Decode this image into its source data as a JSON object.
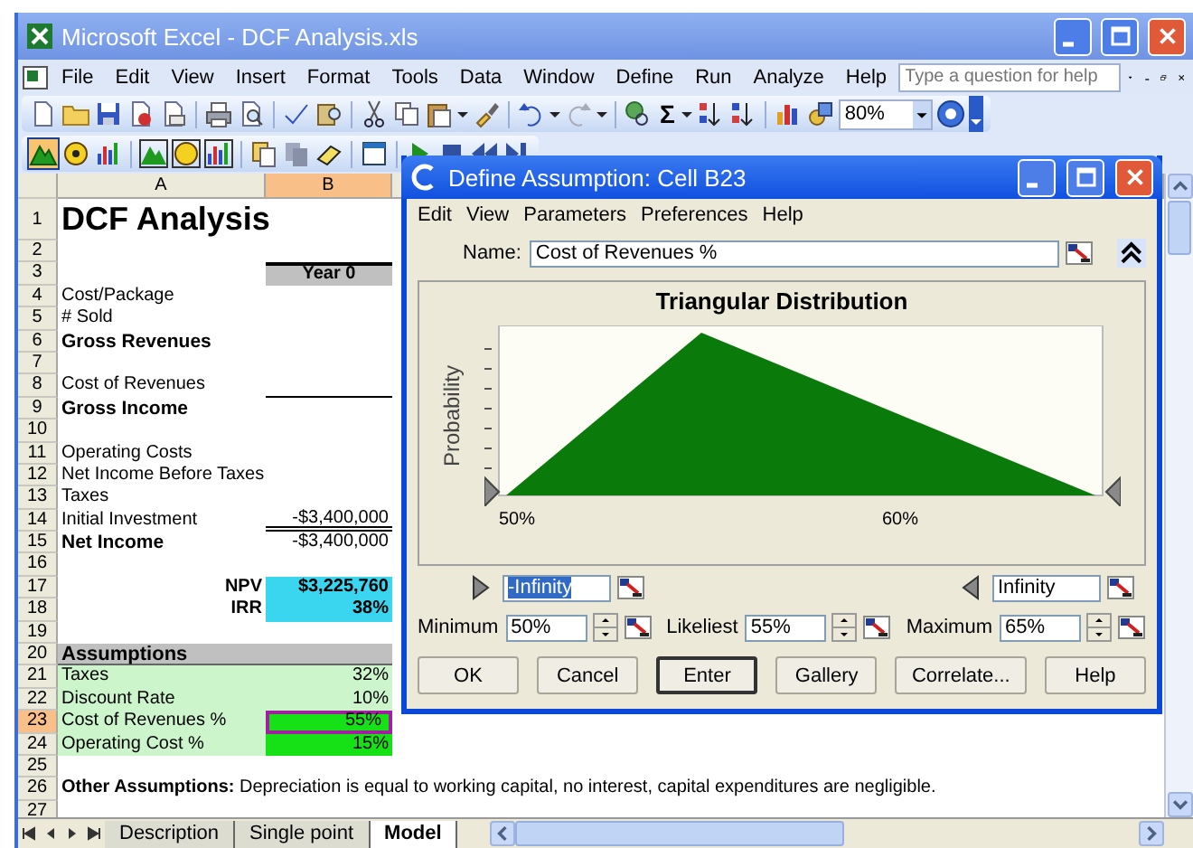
{
  "window": {
    "title": "Microsoft Excel - DCF Analysis.xls"
  },
  "menu": [
    "File",
    "Edit",
    "View",
    "Insert",
    "Format",
    "Tools",
    "Data",
    "Window",
    "Define",
    "Run",
    "Analyze",
    "Help"
  ],
  "help_search": {
    "placeholder": "Type a question for help"
  },
  "toolbar": {
    "autosum": "Σ",
    "zoom": "80%"
  },
  "crystal_toolbar": [
    {
      "selected": true
    },
    {
      "selected": false
    },
    {
      "selected": false
    },
    {
      "selected": false
    },
    {
      "selected": false
    },
    {
      "selected": false
    }
  ],
  "columns": [
    {
      "label": "A",
      "selected": false
    },
    {
      "label": "B",
      "selected": true
    }
  ],
  "rows": [
    {
      "number": "1",
      "kind": "title",
      "a": "DCF Analysis",
      "selected": false
    },
    {
      "number": "2",
      "kind": "blank",
      "selected": false
    },
    {
      "number": "3",
      "kind": "header",
      "b": "Year 0",
      "selected": false
    },
    {
      "number": "4",
      "kind": "plain",
      "a": "Cost/Package",
      "selected": false
    },
    {
      "number": "5",
      "kind": "plain",
      "a": "# Sold",
      "selected": false
    },
    {
      "number": "6",
      "kind": "bold",
      "a": "Gross Revenues",
      "selected": false
    },
    {
      "number": "7",
      "kind": "blank",
      "selected": false
    },
    {
      "number": "8",
      "kind": "ruled",
      "a": "Cost of Revenues",
      "selected": false
    },
    {
      "number": "9",
      "kind": "bold",
      "a": "Gross Income",
      "selected": false
    },
    {
      "number": "10",
      "kind": "blank",
      "selected": false
    },
    {
      "number": "11",
      "kind": "plain",
      "a": "Operating Costs",
      "selected": false
    },
    {
      "number": "12",
      "kind": "plain",
      "a": "Net Income Before Taxes",
      "selected": false
    },
    {
      "number": "13",
      "kind": "plain",
      "a": "Taxes",
      "selected": false
    },
    {
      "number": "14",
      "kind": "double-ruled",
      "a": "Initial Investment",
      "b": "-$3,400,000",
      "selected": false
    },
    {
      "number": "15",
      "kind": "bold",
      "a": "Net Income",
      "b": "-$3,400,000",
      "selected": false
    },
    {
      "number": "16",
      "kind": "blank",
      "selected": false
    },
    {
      "number": "17",
      "kind": "metric",
      "a": "NPV",
      "b": "$3,225,760",
      "selected": false
    },
    {
      "number": "18",
      "kind": "metric",
      "a": "IRR",
      "b": "38%",
      "selected": false
    },
    {
      "number": "19",
      "kind": "blank",
      "selected": false
    },
    {
      "number": "20",
      "kind": "section",
      "a": "Assumptions",
      "selected": false
    },
    {
      "number": "21",
      "kind": "assumption",
      "a": "Taxes",
      "b": "32%",
      "selected": false
    },
    {
      "number": "22",
      "kind": "assumption",
      "a": "Discount Rate",
      "b": "10%",
      "selected": false
    },
    {
      "number": "23",
      "kind": "input",
      "a": "Cost of Revenues %",
      "b": "55%",
      "selected": true
    },
    {
      "number": "24",
      "kind": "input",
      "a": "Operating Cost %",
      "b": "15%",
      "selected": false
    },
    {
      "number": "25",
      "kind": "blank",
      "selected": false
    },
    {
      "number": "26",
      "kind": "note",
      "a": "**Other Assumptions:** Depreciation is equal to working capital, no interest, capital expenditures are negligible.",
      "selected": false
    },
    {
      "number": "27",
      "kind": "blank",
      "selected": false
    }
  ],
  "sheet_tabs": [
    {
      "label": "Description",
      "selected": false
    },
    {
      "label": "Single point",
      "selected": false
    },
    {
      "label": "Model",
      "selected": true
    }
  ],
  "dialog": {
    "title": "Define Assumption: Cell B23",
    "menu": [
      "Edit",
      "View",
      "Parameters",
      "Preferences",
      "Help"
    ],
    "name_label": "Name:",
    "name": "Cost of Revenues %",
    "chart_title": "Triangular Distribution",
    "y_label": "Probability",
    "x_ticks": [
      "50%",
      "60%"
    ],
    "lower_bound": {
      "value": "-Infinity",
      "highlighted": true
    },
    "upper_bound": {
      "value": "Infinity",
      "highlighted": false
    },
    "parameters": [
      {
        "label": "Minimum",
        "value": "50%"
      },
      {
        "label": "Likeliest",
        "value": "55%"
      },
      {
        "label": "Maximum",
        "value": "65%"
      }
    ],
    "buttons": [
      {
        "label": "OK",
        "default": false
      },
      {
        "label": "Cancel",
        "default": false
      },
      {
        "label": "Enter",
        "default": true
      },
      {
        "label": "Gallery",
        "default": false
      },
      {
        "label": "Correlate...",
        "default": false
      },
      {
        "label": "Help",
        "default": false
      }
    ]
  }
}
